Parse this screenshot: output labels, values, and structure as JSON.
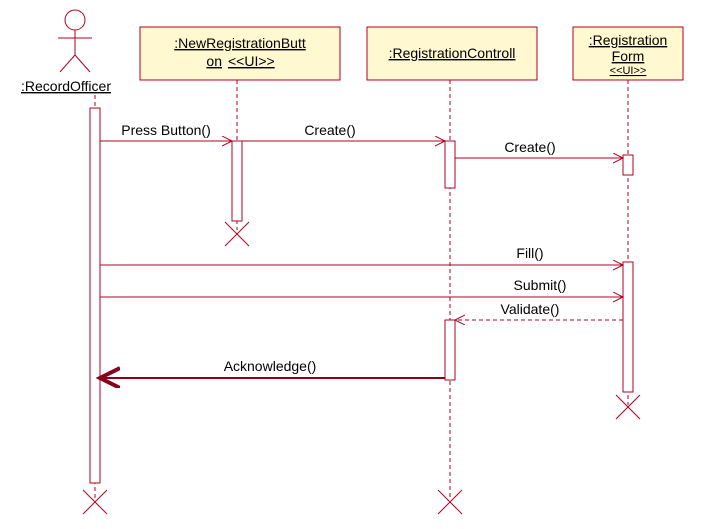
{
  "actor": {
    "name": ":RecordOfficer"
  },
  "lifelines": {
    "button": {
      "title_l1": ":NewRegistrationButt",
      "title_l2": "on",
      "stereo": "<<UI>>"
    },
    "controller": {
      "title": ":RegistrationControll"
    },
    "form": {
      "title_l1": ":Registration",
      "title_l2": "Form",
      "stereo": "<<UI>>"
    }
  },
  "messages": {
    "m1": "Press Button()",
    "m2": "Create()",
    "m3": "Create()",
    "m4": "Fill()",
    "m5": "Submit()",
    "m6": "Validate()",
    "m7": "Acknowledge()"
  },
  "chart_data": {
    "type": "uml-sequence-diagram",
    "actors": [
      {
        "id": "RecordOfficer",
        "name": ":RecordOfficer",
        "kind": "actor"
      },
      {
        "id": "NewRegistrationButton",
        "name": ":NewRegistrationButton",
        "stereotype": "UI",
        "kind": "object"
      },
      {
        "id": "RegistrationControll",
        "name": ":RegistrationControll",
        "kind": "object"
      },
      {
        "id": "RegistrationForm",
        "name": ":RegistrationForm",
        "stereotype": "UI",
        "kind": "object"
      }
    ],
    "messages": [
      {
        "from": "RecordOfficer",
        "to": "NewRegistrationButton",
        "label": "Press Button()",
        "kind": "sync"
      },
      {
        "from": "NewRegistrationButton",
        "to": "RegistrationControll",
        "label": "Create()",
        "kind": "sync"
      },
      {
        "from": "RegistrationControll",
        "to": "RegistrationForm",
        "label": "Create()",
        "kind": "sync"
      },
      {
        "from": "RecordOfficer",
        "to": "RegistrationForm",
        "label": "Fill()",
        "kind": "sync"
      },
      {
        "from": "RecordOfficer",
        "to": "RegistrationForm",
        "label": "Submit()",
        "kind": "sync"
      },
      {
        "from": "RegistrationForm",
        "to": "RegistrationControll",
        "label": "Validate()",
        "kind": "return"
      },
      {
        "from": "RegistrationControll",
        "to": "RecordOfficer",
        "label": "Acknowledge()",
        "kind": "return"
      }
    ],
    "destructions": [
      "NewRegistrationButton",
      "RecordOfficer",
      "RegistrationControll",
      "RegistrationForm"
    ]
  }
}
